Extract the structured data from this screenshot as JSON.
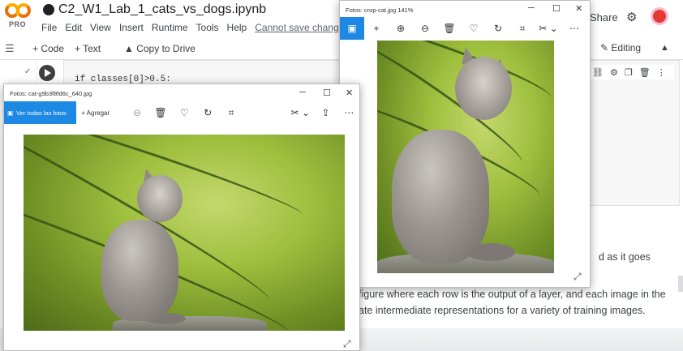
{
  "colab": {
    "logo_text": "PRO",
    "notebook_title": "C2_W1_Lab_1_cats_vs_dogs.ipynb",
    "menu": [
      "File",
      "Edit",
      "View",
      "Insert",
      "Runtime",
      "Tools",
      "Help"
    ],
    "save_status": "Cannot save changes",
    "share_label": "Share",
    "add_code_label": "+ Code",
    "add_text_label": "+ Text",
    "copy_to_drive_label": "Copy to Drive",
    "editing_label": "Editing",
    "code_line": "if classes[0]>0.5:",
    "text_lines": [
      "d as it goes",
      "figure where each row is the output of a layer, and each image in the",
      "ate intermediate representations for a variety of training images."
    ]
  },
  "photo_windows": {
    "left": {
      "title": "Fotos: cat-g9b3f8fd6c_640.jpg",
      "view_all_label": "Ver todas las fotos",
      "add_label": "Agregar"
    },
    "right": {
      "title": "Fotos: crop-cat.jpg   141%"
    }
  },
  "icons": {
    "minimize": "minimize-icon",
    "maximize": "maximize-icon",
    "close": "close-icon",
    "zoom_in": "zoom-in-icon",
    "zoom_out": "zoom-out-icon",
    "delete": "trash-icon",
    "favorite": "heart-icon",
    "rotate": "rotate-icon",
    "crop": "crop-icon",
    "edit": "edit-icon",
    "share": "share-icon",
    "more": "more-icon"
  },
  "colors": {
    "accent": "#1e88e5",
    "colab_orange": "#f9ab00"
  }
}
